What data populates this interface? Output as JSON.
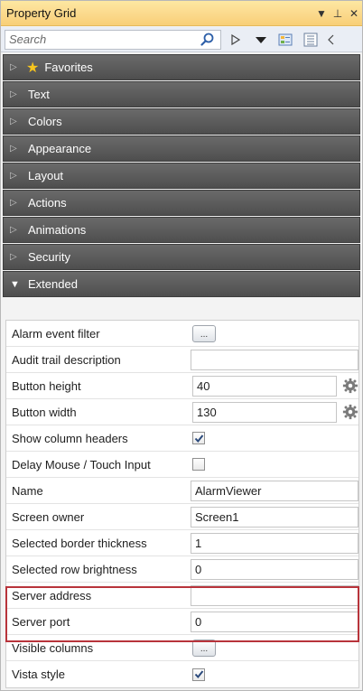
{
  "titlebar": {
    "title": "Property Grid",
    "pin_glyph": "↓ ⚕",
    "close_glyph": "×"
  },
  "search": {
    "placeholder": "Search"
  },
  "categories": [
    {
      "label": "Favorites",
      "icon": "star-icon",
      "expanded": false
    },
    {
      "label": "Text",
      "expanded": false
    },
    {
      "label": "Colors",
      "expanded": false
    },
    {
      "label": "Appearance",
      "expanded": false
    },
    {
      "label": "Layout",
      "expanded": false
    },
    {
      "label": "Actions",
      "expanded": false
    },
    {
      "label": "Animations",
      "expanded": false
    },
    {
      "label": "Security",
      "expanded": false
    },
    {
      "label": "Extended",
      "expanded": true
    }
  ],
  "properties": [
    {
      "name": "Alarm event filter",
      "type": "ellipsis"
    },
    {
      "name": "Audit trail description",
      "type": "text",
      "value": ""
    },
    {
      "name": "Button height",
      "type": "text-gear",
      "value": "40"
    },
    {
      "name": "Button width",
      "type": "text-gear",
      "value": "130"
    },
    {
      "name": "Show column headers",
      "type": "checkbox",
      "checked": true
    },
    {
      "name": "Delay Mouse / Touch Input",
      "type": "checkbox",
      "checked": false
    },
    {
      "name": "Name",
      "type": "text",
      "value": "AlarmViewer"
    },
    {
      "name": "Screen owner",
      "type": "text",
      "value": "Screen1"
    },
    {
      "name": "Selected border thickness",
      "type": "text",
      "value": "1"
    },
    {
      "name": "Selected row brightness",
      "type": "text",
      "value": "0"
    },
    {
      "name": "Server address",
      "type": "text",
      "value": ""
    },
    {
      "name": "Server port",
      "type": "text",
      "value": "0"
    },
    {
      "name": "Visible columns",
      "type": "ellipsis"
    },
    {
      "name": "Vista style",
      "type": "checkbox",
      "checked": true
    }
  ],
  "colors": {
    "highlight": "#b8343b",
    "header_bg": "#5a5a5a",
    "title_bg": "#fbd98c"
  }
}
